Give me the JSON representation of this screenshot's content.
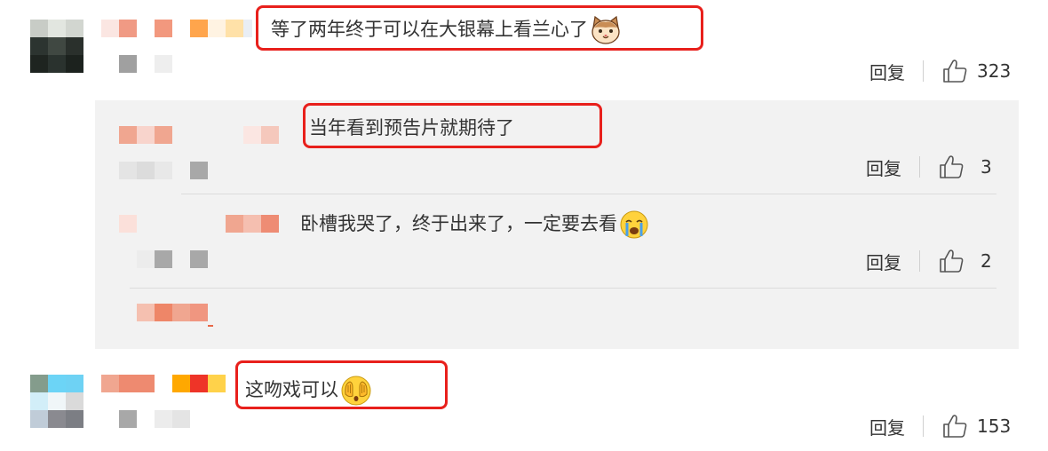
{
  "comments": [
    {
      "text": "等了两年终于可以在大银幕上看兰心了",
      "emoji": "cat-face-emoji",
      "reply_label": "回复",
      "likes": "323"
    },
    {
      "text": "这吻戏可以",
      "emoji": "covering-face-emoji",
      "reply_label": "回复",
      "likes": "153"
    }
  ],
  "replies": [
    {
      "text": "当年看到预告片就期待了",
      "reply_label": "回复",
      "likes": "3"
    },
    {
      "text": "卧槽我哭了，终于出来了，一定要去看",
      "emoji": "crying-face-emoji",
      "reply_label": "回复",
      "likes": "2"
    }
  ],
  "colors": {
    "highlight": "#e8201c",
    "reply_bg": "#f2f2f2"
  }
}
